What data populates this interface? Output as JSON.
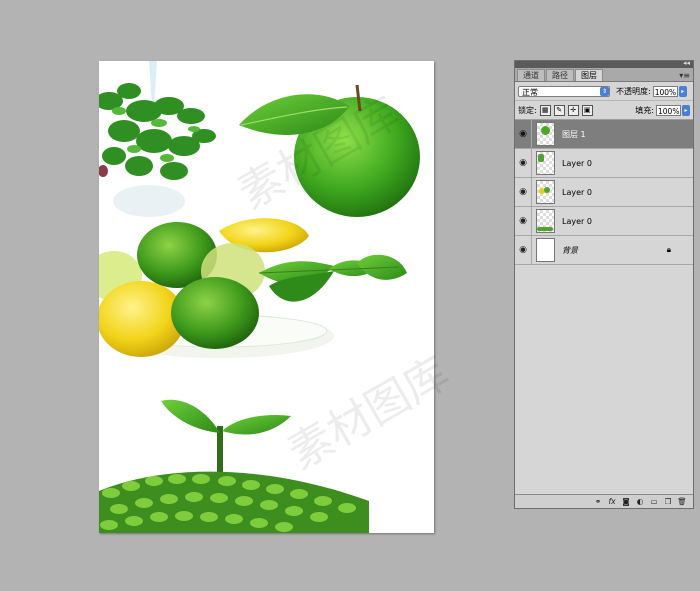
{
  "layers_panel": {
    "tabs": [
      "通道",
      "路径",
      "图层"
    ],
    "active_tab": 2,
    "menu_icon": "panel-menu-icon",
    "blend_mode": "正常",
    "opacity_label": "不透明度:",
    "opacity_value": "100%",
    "lock_label": "锁定:",
    "fill_label": "填充:",
    "fill_value": "100%",
    "layers": [
      {
        "name": "图层 1",
        "selected": true
      },
      {
        "name": "Layer 0",
        "selected": false
      },
      {
        "name": "Layer 0",
        "selected": false
      },
      {
        "name": "Layer 0",
        "selected": false
      },
      {
        "name": "背景",
        "selected": false,
        "locked": true
      }
    ],
    "bottom_icons": [
      "link-layers-icon",
      "fx-icon",
      "mask-icon",
      "adjustment-icon",
      "group-icon",
      "new-layer-icon",
      "trash-icon"
    ]
  },
  "canvas": {
    "content": [
      "vegetable-bunch",
      "green-apple",
      "limes-and-lemons-plate",
      "seedling-sprout",
      "green-sprouts"
    ]
  },
  "watermark": "素材图库"
}
